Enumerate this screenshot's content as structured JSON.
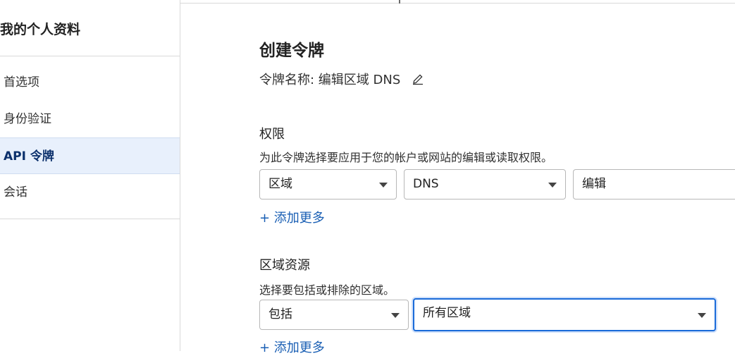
{
  "sidebar": {
    "title": "我的个人资料",
    "items": [
      {
        "label": "首选项"
      },
      {
        "label": "身份验证"
      },
      {
        "label": "API 令牌"
      },
      {
        "label": "会话"
      }
    ]
  },
  "main": {
    "title": "创建令牌",
    "token_name_label": "令牌名称: 编辑区域 DNS",
    "permissions": {
      "label": "权限",
      "description": "为此令牌选择要应用于您的帐户或网站的编辑或读取权限。",
      "select_1": "区域",
      "select_2": "DNS",
      "select_3": "编辑",
      "add_more": "+ 添加更多"
    },
    "zone_resources": {
      "label": "区域资源",
      "description": "选择要包括或排除的区域。",
      "select_1": "包括",
      "select_2": "所有区域",
      "add_more": "+ 添加更多"
    }
  },
  "colors": {
    "accent": "#1a6bd9",
    "link": "#1a5fb4",
    "active_bg": "#e8f0fc"
  },
  "icons": [
    "pencil-icon",
    "chevron-down-icon"
  ]
}
